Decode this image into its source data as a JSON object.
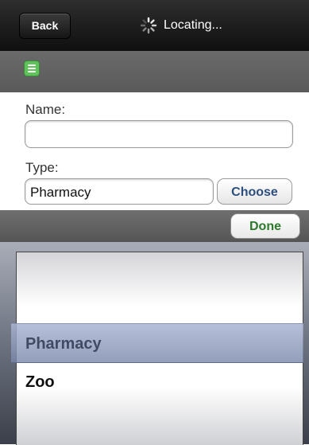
{
  "navbar": {
    "back_label": "Back",
    "title": "Locating..."
  },
  "form": {
    "name_label": "Name:",
    "name_value": "",
    "type_label": "Type:",
    "type_value": "Pharmacy",
    "choose_label": "Choose"
  },
  "picker": {
    "done_label": "Done",
    "options": [
      "Pharmacy",
      "Zoo"
    ],
    "selected": "Pharmacy"
  },
  "colors": {
    "done_text": "#2d7a2d",
    "choose_text": "#2d4f7d",
    "menu_icon": "#5fc25a"
  }
}
